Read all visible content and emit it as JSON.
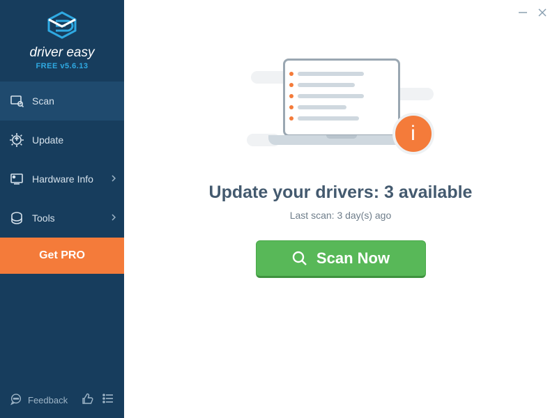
{
  "app": {
    "name": "driver easy",
    "version_line": "FREE v5.6.13"
  },
  "sidebar": {
    "items": [
      {
        "label": "Scan",
        "icon": "scan-icon",
        "active": true,
        "chevron": false
      },
      {
        "label": "Update",
        "icon": "update-icon",
        "active": false,
        "chevron": false
      },
      {
        "label": "Hardware Info",
        "icon": "hardware-icon",
        "active": false,
        "chevron": true
      },
      {
        "label": "Tools",
        "icon": "tools-icon",
        "active": false,
        "chevron": true
      }
    ],
    "getpro_label": "Get PRO",
    "footer": {
      "feedback_label": "Feedback"
    }
  },
  "main": {
    "headline": "Update your drivers: 3 available",
    "subline": "Last scan: 3 day(s) ago",
    "scan_button_label": "Scan Now",
    "info_badge_glyph": "i"
  },
  "colors": {
    "sidebar_bg": "#173d5d",
    "accent_orange": "#f47b3a",
    "accent_green": "#58b858",
    "brand_blue": "#2fa9e2"
  }
}
